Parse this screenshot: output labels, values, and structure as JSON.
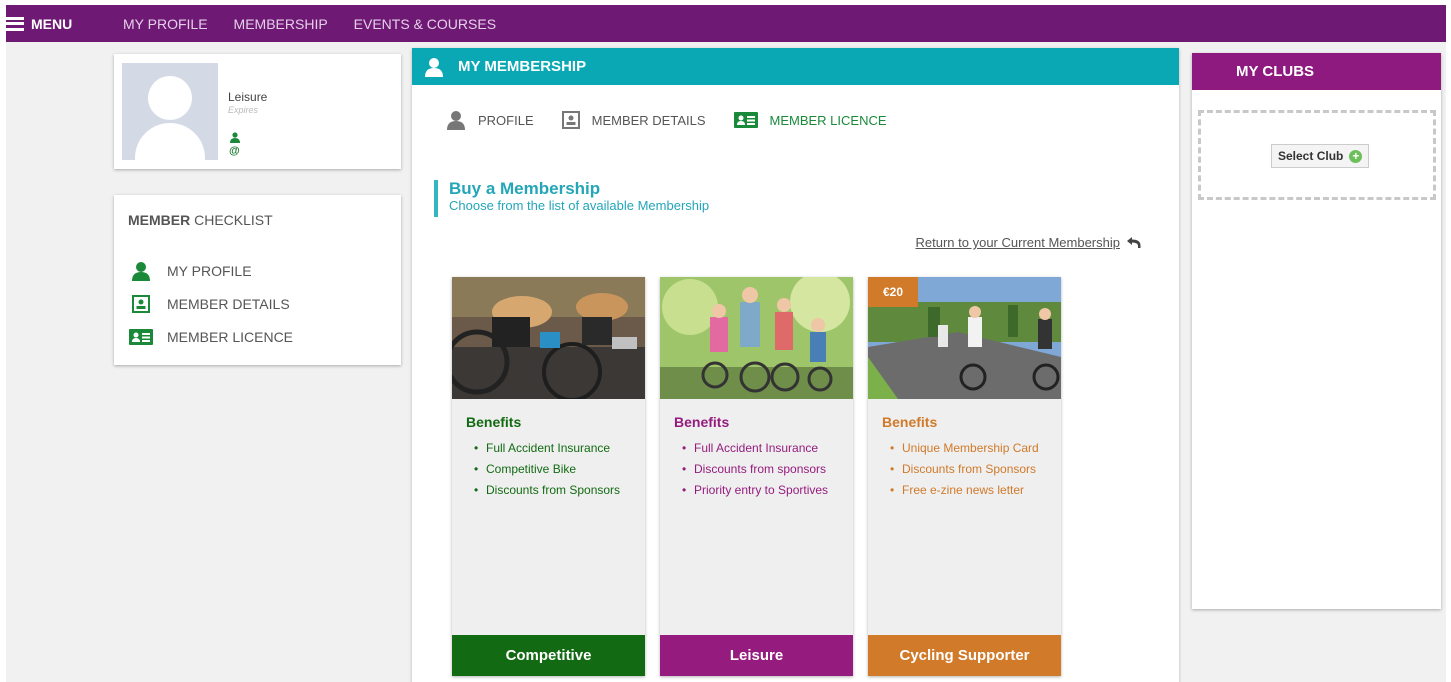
{
  "nav": {
    "menu_label": "MENU",
    "links": [
      "MY PROFILE",
      "MEMBERSHIP",
      "EVENTS & COURSES"
    ]
  },
  "profile": {
    "name": "Leisure",
    "expires_label": "Expires",
    "email_symbol": "@"
  },
  "checklist": {
    "title_bold": "MEMBER",
    "title_rest": " CHECKLIST",
    "items": [
      "MY PROFILE",
      "MEMBER DETAILS",
      "MEMBER LICENCE"
    ]
  },
  "membership": {
    "header": "MY MEMBERSHIP",
    "tabs": [
      "PROFILE",
      "MEMBER DETAILS",
      "MEMBER LICENCE"
    ],
    "active_tab": "MEMBER LICENCE",
    "buy_title": "Buy a Membership",
    "buy_subtitle": "Choose from the list of available Membership",
    "return_link": "Return to your Current Membership",
    "cards": [
      {
        "name": "Competitive",
        "benefits_title": "Benefits",
        "benefits": [
          "Full Accident Insurance",
          "Competitive Bike",
          "Discounts from Sponsors"
        ],
        "color": "#126b12",
        "price": ""
      },
      {
        "name": "Leisure",
        "benefits_title": "Benefits",
        "benefits": [
          "Full Accident Insurance",
          "Discounts from sponsors",
          "Priority entry to Sportives"
        ],
        "color": "#951c7e",
        "price": ""
      },
      {
        "name": "Cycling Supporter",
        "benefits_title": "Benefits",
        "benefits": [
          "Unique Membership Card",
          "Discounts from Sponsors",
          "Free e-zine news letter"
        ],
        "color": "#d07a2a",
        "price": "€20"
      }
    ]
  },
  "clubs": {
    "header": "MY CLUBS",
    "select_label": "Select Club"
  },
  "colors": {
    "nav_bg": "#6e1a74",
    "teal": "#0aa8b5",
    "green": "#1a8a3a",
    "clubs_header": "#8e1a80"
  }
}
